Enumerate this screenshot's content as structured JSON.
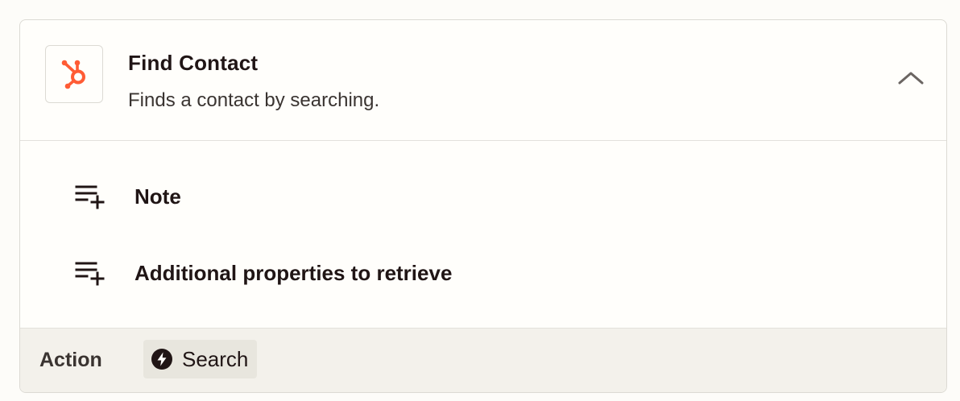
{
  "colors": {
    "hubspot_orange": "#ff5c35",
    "text_primary": "#201515",
    "footer_bg": "#f3f1eb",
    "badge_bg": "#e8e6de"
  },
  "step": {
    "app_icon": "hubspot-icon",
    "title": "Find Contact",
    "description": "Finds a contact by searching.",
    "collapse_icon": "chevron-up-icon"
  },
  "fields": [
    {
      "icon": "playlist-add-icon",
      "label": "Note"
    },
    {
      "icon": "playlist-add-icon",
      "label": "Additional properties to retrieve"
    }
  ],
  "footer": {
    "label": "Action",
    "badge_icon": "bolt-icon",
    "badge_label": "Search"
  }
}
